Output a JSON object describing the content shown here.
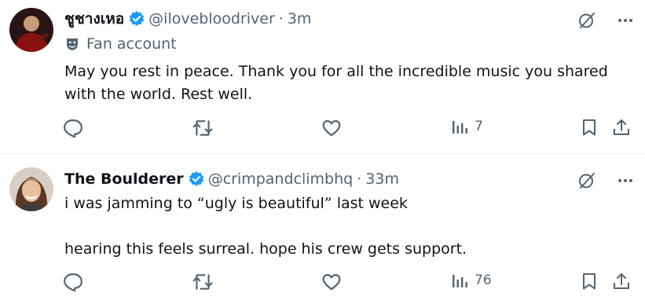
{
  "tweets": [
    {
      "display_name": "ชูชางเหอ",
      "handle": "@ilovebloodriver",
      "separator": "·",
      "time": "3m",
      "fan_label": "Fan account",
      "text": "May you rest in peace. Thank you for all the incredible music you shared\nwith the world. Rest well.",
      "views": "7"
    },
    {
      "display_name": "The Boulderer",
      "handle": "@crimpandclimbhq",
      "separator": "·",
      "time": "33m",
      "text": "i was jamming to “ugly is beautiful” last week\n\nhearing this feels surreal. hope his crew gets support.",
      "views": "76"
    }
  ],
  "colors": {
    "text": "#0f1419",
    "secondary": "#536471",
    "verified": "#1d9bf0",
    "divider": "#eff3f4"
  },
  "icons": [
    "grok-icon",
    "more-icon",
    "reply-icon",
    "retweet-icon",
    "like-icon",
    "views-icon",
    "bookmark-icon",
    "share-icon",
    "verified-icon",
    "fan-mask-icon"
  ]
}
